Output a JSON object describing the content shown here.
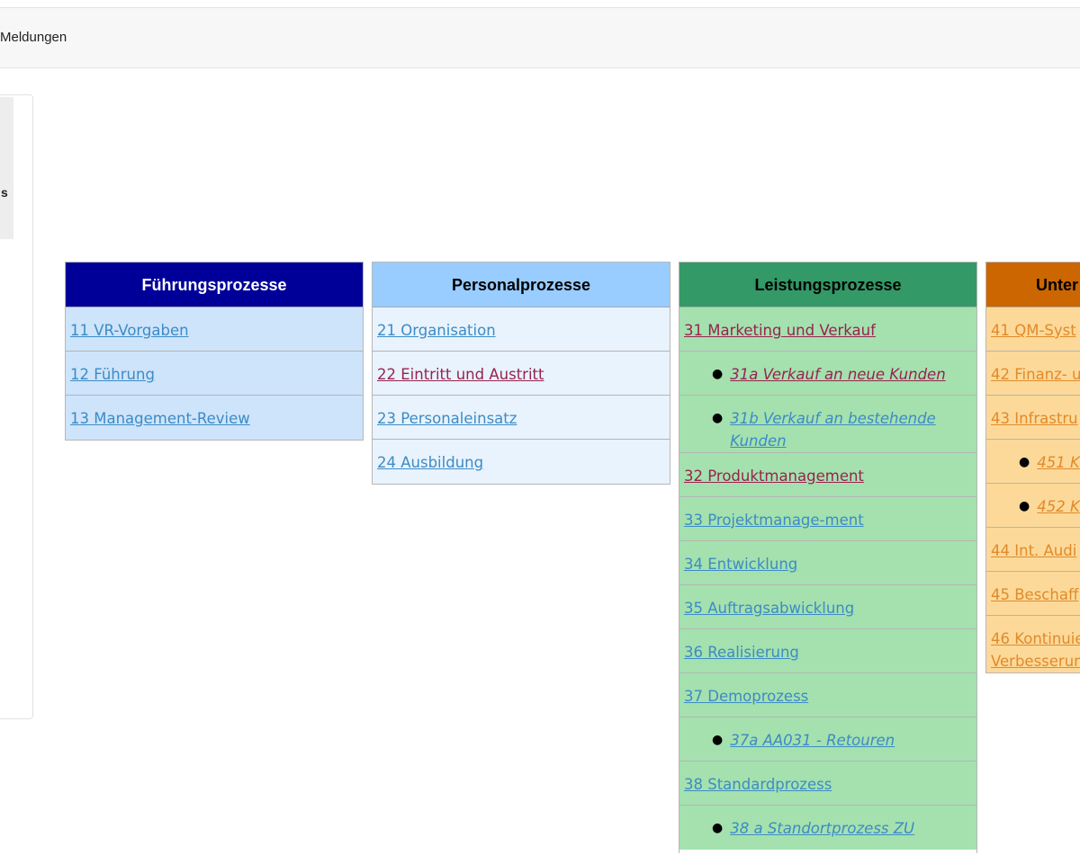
{
  "topbar": {
    "nav_text": "Meldungen"
  },
  "sidepanel": {
    "item_text": "s"
  },
  "columns": [
    {
      "header": "Führungsprozesse",
      "header_bg": "#000099",
      "header_color": "#ffffff",
      "cell_bg": "#cde4fb",
      "cells": [
        {
          "label": "11 VR-Vorgaben",
          "type": "main",
          "color": "blue"
        },
        {
          "label": "12 Führung",
          "type": "main",
          "color": "blue"
        },
        {
          "label": "13 Management-Review",
          "type": "main",
          "color": "blue"
        }
      ]
    },
    {
      "header": "Personalprozesse",
      "header_bg": "#99ccff",
      "header_color": "#000000",
      "cell_bg": "#e8f3fd",
      "cells": [
        {
          "label": "21 Organisation",
          "type": "main",
          "color": "blue"
        },
        {
          "label": "22 Eintritt und Austritt",
          "type": "main",
          "color": "purple"
        },
        {
          "label": "23 Personaleinsatz",
          "type": "main",
          "color": "blue"
        },
        {
          "label": "24 Ausbildung",
          "type": "main",
          "color": "blue"
        }
      ]
    },
    {
      "header": "Leistungsprozesse",
      "header_bg": "#339966",
      "header_color": "#000000",
      "cell_bg": "#a4e1ae",
      "cells": [
        {
          "label": "31 Marketing und Verkauf",
          "type": "main",
          "color": "purple"
        },
        {
          "label": "31a Verkauf an neue Kunden",
          "type": "sub",
          "color": "purple"
        },
        {
          "label": "31b Verkauf an bestehende Kunden",
          "type": "sub",
          "color": "blue"
        },
        {
          "label": "32 Produktmanagement",
          "type": "main",
          "color": "purple"
        },
        {
          "label": "33 Projektmanage-ment",
          "type": "main",
          "color": "blue"
        },
        {
          "label": "34 Entwicklung",
          "type": "main",
          "color": "blue"
        },
        {
          "label": "35 Auftragsabwicklung",
          "type": "main",
          "color": "blue"
        },
        {
          "label": "36 Realisierung",
          "type": "main",
          "color": "blue"
        },
        {
          "label": "37 Demoprozess",
          "type": "main",
          "color": "blue"
        },
        {
          "label": "37a AA031 - Retouren",
          "type": "sub",
          "color": "blue"
        },
        {
          "label": "38 Standardprozess",
          "type": "main",
          "color": "blue"
        },
        {
          "label": "38 a Standortprozess ZU",
          "type": "sub",
          "color": "blue"
        }
      ]
    },
    {
      "header": "Unter",
      "header_bg": "#cc6600",
      "header_color": "#000000",
      "cell_bg": "#fdd999",
      "cells": [
        {
          "label": "41 QM-Syst",
          "type": "main",
          "color": "orange"
        },
        {
          "label": "42 Finanz- u",
          "type": "main",
          "color": "orange"
        },
        {
          "label": "43 Infrastru",
          "type": "main",
          "color": "orange"
        },
        {
          "label": "451 K",
          "type": "sub",
          "color": "orange"
        },
        {
          "label": "452 K",
          "type": "sub",
          "color": "orange"
        },
        {
          "label": "44 Int. Audi",
          "type": "main",
          "color": "orange"
        },
        {
          "label": "45 Beschaff",
          "type": "main",
          "color": "orange"
        },
        {
          "label": "46 Kontinuie Verbesserun",
          "type": "main",
          "color": "orange"
        }
      ]
    }
  ]
}
